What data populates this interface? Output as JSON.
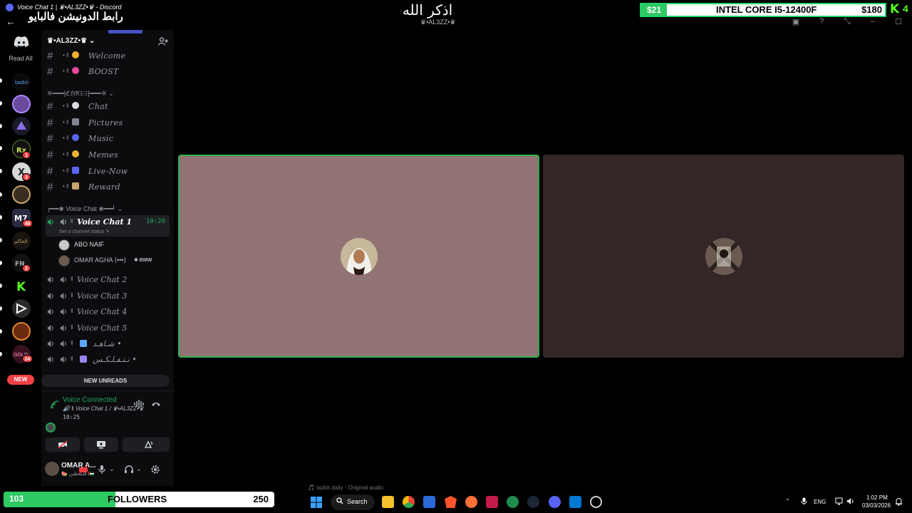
{
  "window": {
    "small_title": "Voice Chat 1 | ♛•AL3ZZ•♛ - Discord",
    "link_text": "رابط الدونيشن فالبايو"
  },
  "overlay": {
    "center_title": "اذكر الله",
    "center_subtitle": "♛•AL3ZZ•♛",
    "cpu_left": "$21",
    "cpu_name": "INTEL CORE I5-12400F",
    "cpu_right": "$180",
    "kick_count": "4"
  },
  "rail": {
    "read_all": "Read All",
    "badges": [
      "1",
      "3",
      "48",
      "2",
      "24"
    ],
    "new_label": "NEW"
  },
  "server": {
    "name": "♛•AL3ZZ•♛"
  },
  "channels": [
    {
      "prefix": "• ‖",
      "name": "Welcome",
      "color": "#f0b232"
    },
    {
      "prefix": "• ‖",
      "name": "BOOST",
      "color": "#eb459e"
    },
    {
      "prefix": "• ‖",
      "name": "Chat",
      "color": "#dbdee1"
    },
    {
      "prefix": "• ‖",
      "name": "Pictures",
      "color": "#80848e"
    },
    {
      "prefix": "• ‖",
      "name": "Music",
      "color": "#5865f2"
    },
    {
      "prefix": "• ‖",
      "name": "Memes",
      "color": "#f0b232"
    },
    {
      "prefix": "• ‖",
      "name": "Live-Now",
      "color": "#5865f2"
    },
    {
      "prefix": "• ‖",
      "name": "Reward",
      "color": "#f0b232"
    }
  ],
  "categories": {
    "chats": "※━━━|ℭℌ𝔄𝔗𝔖|━━━※",
    "voice": "┍━━❀ Voice Chat ❀━━┙"
  },
  "voice_channels": {
    "active": {
      "name": "Voice Chat 1",
      "timer": "10:20",
      "status_placeholder": "Set a channel status"
    },
    "users": [
      {
        "name": "ABO NAIF",
        "tag": ""
      },
      {
        "name": "OMAR AGHA ⟨•••⟩",
        "tag": "✥ BMW"
      }
    ],
    "others": [
      "Voice Chat 2",
      "Voice Chat 3",
      "Voice Chat 4",
      "Voice Chat 5",
      "شـاهـد •",
      "نـتـفـلـكـس •"
    ]
  },
  "new_unreads": "NEW UNREADS",
  "voice_panel": {
    "status": "Voice Connected",
    "path": "🔊 ‖ Voice Chat 1 / ♛•AL3ZZ•♛",
    "elapsed": "10:25"
  },
  "user_panel": {
    "name": "OMAR A...",
    "sub": "🍉 فلسطين 🇵🇸"
  },
  "followers": {
    "count": "103",
    "label": "FOLLOWERS",
    "goal": "250",
    "progress": 0.412
  },
  "audio_caption": "🎵 tazkir.daily · Original audio",
  "taskbar": {
    "search": "Search",
    "lang": "ENG",
    "time": "1:02 PM",
    "date": "03/03/2026"
  },
  "colors": {
    "accent_green": "#23a55a",
    "discord_blurple": "#5865f2",
    "tile_active": "#917373",
    "tile_other": "#342526"
  }
}
